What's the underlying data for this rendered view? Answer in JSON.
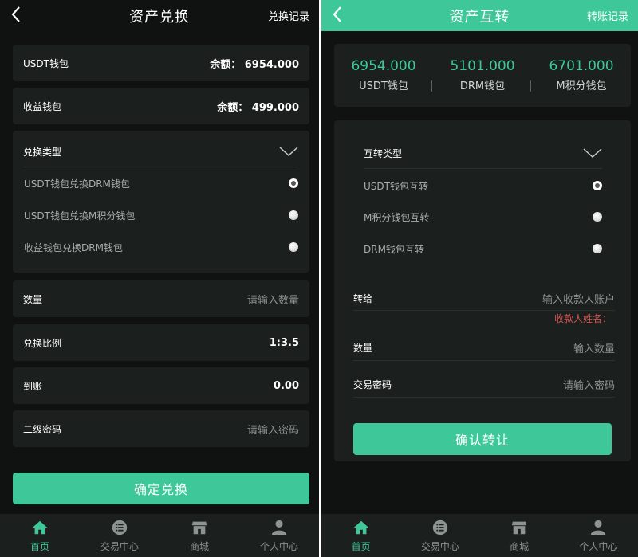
{
  "colors": {
    "accent": "#3ec899",
    "background": "#0f1211",
    "card": "#1b1f1e",
    "warning": "#d9534f"
  },
  "exchange": {
    "header": {
      "title": "资产兑换",
      "right_link": "兑换记录",
      "back_icon": "chevron-left-icon"
    },
    "usdt_wallet": {
      "label": "USDT钱包",
      "balance": "余额： 6954.000"
    },
    "profit_wallet": {
      "label": "收益钱包",
      "balance": "余额： 499.000"
    },
    "type": {
      "label": "兑换类型",
      "options": [
        {
          "label": "USDT钱包兑换DRM钱包",
          "checked": true
        },
        {
          "label": "USDT钱包兑换M积分钱包",
          "checked": false
        },
        {
          "label": "收益钱包兑换DRM钱包",
          "checked": false
        }
      ]
    },
    "quantity": {
      "label": "数量",
      "placeholder": "请输入数量"
    },
    "ratio": {
      "label": "兑换比例",
      "value": "1:3.5"
    },
    "arrival": {
      "label": "到账",
      "value": "0.00"
    },
    "password": {
      "label": "二级密码",
      "placeholder": "请输入密码"
    },
    "submit_label": "确定兑换"
  },
  "transfer": {
    "header": {
      "title": "资产互转",
      "right_link": "转账记录",
      "back_icon": "chevron-left-icon"
    },
    "balances": [
      {
        "value": "6954.000",
        "label": "USDT钱包"
      },
      {
        "value": "5101.000",
        "label": "DRM钱包"
      },
      {
        "value": "6701.000",
        "label": "M积分钱包"
      }
    ],
    "type": {
      "label": "互转类型",
      "options": [
        {
          "label": "USDT钱包互转",
          "checked": true
        },
        {
          "label": "M积分钱包互转",
          "checked": false
        },
        {
          "label": "DRM钱包互转",
          "checked": false
        }
      ]
    },
    "recipient": {
      "label": "转给",
      "placeholder": "输入收款人账户",
      "name_hint": "收款人姓名："
    },
    "quantity": {
      "label": "数量",
      "placeholder": "输入数量"
    },
    "password": {
      "label": "交易密码",
      "placeholder": "请输入密码"
    },
    "submit_label": "确认转让"
  },
  "tabbar": [
    {
      "label": "首页",
      "icon": "home-icon",
      "active": true
    },
    {
      "label": "交易中心",
      "icon": "list-icon",
      "active": false
    },
    {
      "label": "商城",
      "icon": "shop-icon",
      "active": false
    },
    {
      "label": "个人中心",
      "icon": "user-icon",
      "active": false
    }
  ]
}
